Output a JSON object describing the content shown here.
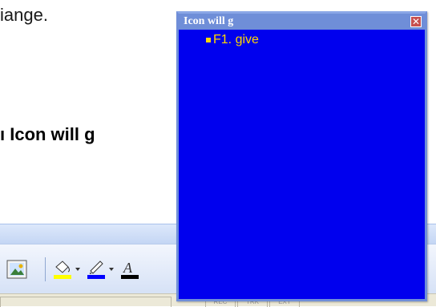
{
  "document": {
    "line1": "iange.",
    "line2": "ı Icon will g"
  },
  "popup": {
    "title": "Icon will g",
    "close_glyph": "✕",
    "items": [
      {
        "label": "F1. give"
      }
    ]
  },
  "toolbar": {
    "icons": [
      "picture-icon",
      "fill-color-icon",
      "line-color-icon",
      "font-color-icon"
    ],
    "colors": {
      "fill": "#ffff00",
      "line": "#0000ff",
      "font": "#000000"
    }
  },
  "statusbar": {
    "cells": [
      "",
      "REC",
      "TRK",
      "EXT"
    ]
  }
}
